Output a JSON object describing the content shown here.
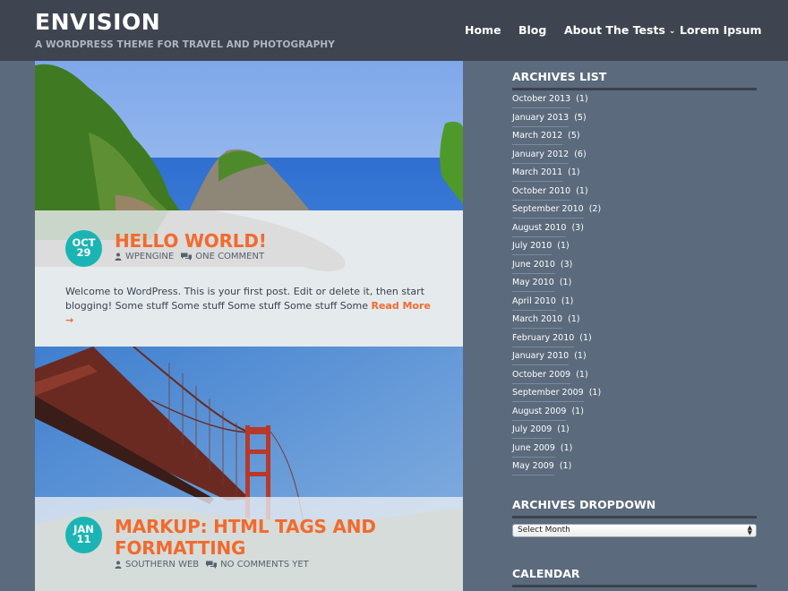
{
  "header": {
    "site_title": "ENVISION",
    "tagline": "A WORDPRESS THEME FOR TRAVEL AND PHOTOGRAPHY"
  },
  "nav": {
    "items": [
      {
        "label": "Home"
      },
      {
        "label": "Blog"
      },
      {
        "label": "About The Tests",
        "has_submenu": true
      },
      {
        "label": "Lorem Ipsum"
      }
    ]
  },
  "posts": [
    {
      "month": "OCT",
      "day": "29",
      "title": "HELLO WORLD!",
      "author": "WPENGINE",
      "comments": "ONE COMMENT",
      "excerpt": "Welcome to WordPress. This is your first post. Edit or delete it, then start blogging!   Some stuff Some stuff Some stuff Some stuff Some ",
      "read_more": "Read More →",
      "image": "coastal-cliffs-ocean"
    },
    {
      "month": "JAN",
      "day": "11",
      "title": "MARKUP: HTML TAGS AND FORMATTING",
      "author": "SOUTHERN WEB",
      "comments": "NO COMMENTS YET",
      "image": "golden-gate-bridge"
    }
  ],
  "sidebar": {
    "archives_list": {
      "title": "ARCHIVES LIST",
      "items": [
        {
          "label": "October 2013",
          "count": "(1)"
        },
        {
          "label": "January 2013",
          "count": "(5)"
        },
        {
          "label": "March 2012",
          "count": "(5)"
        },
        {
          "label": "January 2012",
          "count": "(6)"
        },
        {
          "label": "March 2011",
          "count": "(1)"
        },
        {
          "label": "October 2010",
          "count": "(1)"
        },
        {
          "label": "September 2010",
          "count": "(2)"
        },
        {
          "label": "August 2010",
          "count": "(3)"
        },
        {
          "label": "July 2010",
          "count": "(1)"
        },
        {
          "label": "June 2010",
          "count": "(3)"
        },
        {
          "label": "May 2010",
          "count": "(1)"
        },
        {
          "label": "April 2010",
          "count": "(1)"
        },
        {
          "label": "March 2010",
          "count": "(1)"
        },
        {
          "label": "February 2010",
          "count": "(1)"
        },
        {
          "label": "January 2010",
          "count": "(1)"
        },
        {
          "label": "October 2009",
          "count": "(1)"
        },
        {
          "label": "September 2009",
          "count": "(1)"
        },
        {
          "label": "August 2009",
          "count": "(1)"
        },
        {
          "label": "July 2009",
          "count": "(1)"
        },
        {
          "label": "June 2009",
          "count": "(1)"
        },
        {
          "label": "May 2009",
          "count": "(1)"
        }
      ]
    },
    "archives_dropdown": {
      "title": "ARCHIVES DROPDOWN",
      "selected": "Select Month"
    },
    "calendar": {
      "title": "CALENDAR"
    }
  },
  "colors": {
    "header_bg": "#3e4550",
    "page_bg": "#5b6a7c",
    "accent_orange": "#f26a2e",
    "date_badge": "#1bb4b4"
  }
}
